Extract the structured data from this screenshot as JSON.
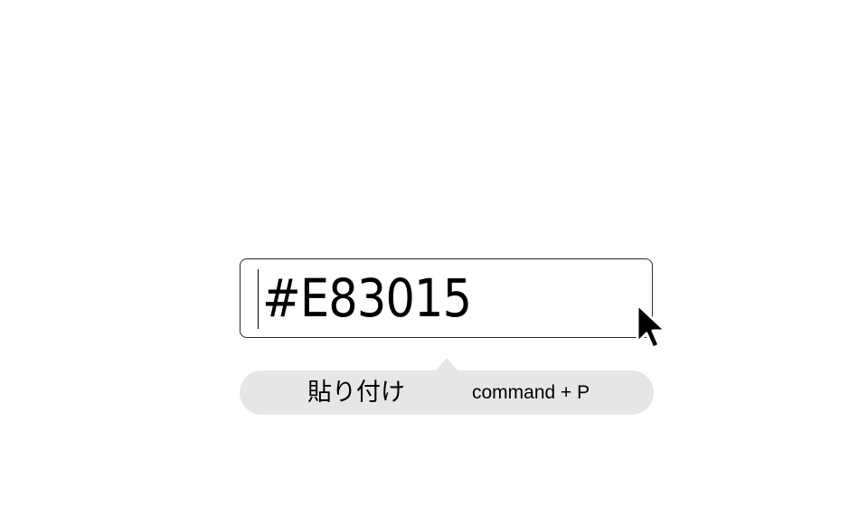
{
  "color_field": {
    "value": "#E83015"
  },
  "context_menu": {
    "items": [
      {
        "label": "貼り付け",
        "shortcut": "command + P"
      }
    ]
  },
  "cursor": {
    "icon": "mouse-pointer-icon"
  },
  "colors": {
    "menu_background": "#e6e6e6",
    "field_border": "#2a2a2a"
  }
}
